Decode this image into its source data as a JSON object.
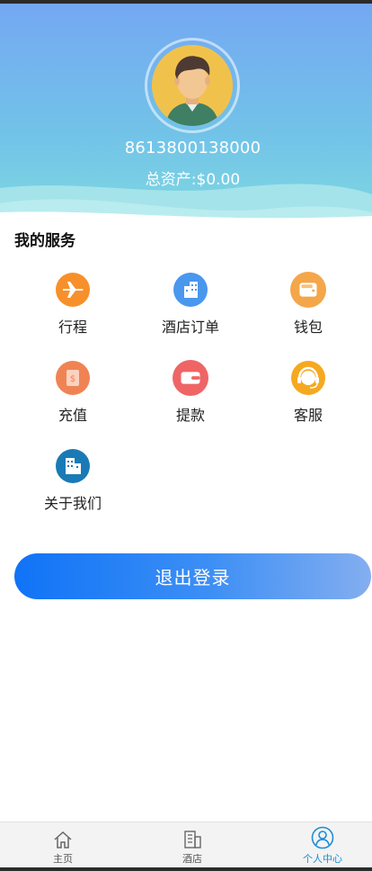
{
  "profile": {
    "phone": "8613800138000",
    "assets": "总资产:$0.00"
  },
  "services": {
    "title": "我的服务",
    "items": [
      {
        "label": "行程",
        "icon": "airplane-icon",
        "color": "#f7902a"
      },
      {
        "label": "酒店订单",
        "icon": "building-icon",
        "color": "#4a97ee"
      },
      {
        "label": "钱包",
        "icon": "wallet-icon",
        "color": "#f4a64a"
      },
      {
        "label": "充值",
        "icon": "recharge-icon",
        "color": "#f08354"
      },
      {
        "label": "提款",
        "icon": "withdraw-icon",
        "color": "#ef6566"
      },
      {
        "label": "客服",
        "icon": "headset-icon",
        "color": "#f6a81f"
      },
      {
        "label": "关于我们",
        "icon": "office-icon",
        "color": "#1a7ab6"
      }
    ]
  },
  "logout_label": "退出登录",
  "tabs": [
    {
      "label": "主页",
      "icon": "home-icon"
    },
    {
      "label": "酒店",
      "icon": "hotel-icon"
    },
    {
      "label": "个人中心",
      "icon": "user-icon",
      "active": true
    }
  ],
  "colors": {
    "header_top": "#74aaf2",
    "header_bottom": "#77d5e0",
    "accent": "#1a8ed8",
    "button_start": "#1073f6",
    "button_end": "#84aef0"
  }
}
